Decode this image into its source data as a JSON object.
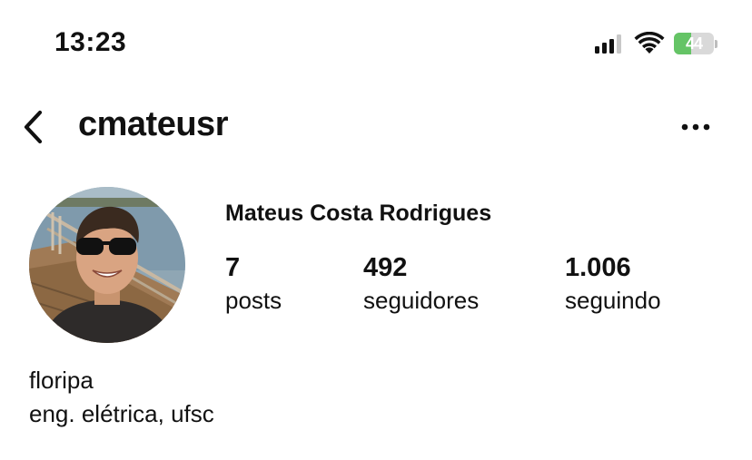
{
  "status_bar": {
    "time": "13:23",
    "battery_level": "44",
    "battery_fraction": 0.44,
    "icons": [
      "signal-icon",
      "wifi-icon",
      "battery-icon"
    ]
  },
  "header": {
    "username": "cmateusr",
    "icons": [
      "back-chevron-icon",
      "more-options-icon"
    ]
  },
  "profile": {
    "full_name": "Mateus Costa Rodrigues",
    "stats": [
      {
        "value": "7",
        "label": "posts"
      },
      {
        "value": "492",
        "label": "seguidores"
      },
      {
        "value": "1.006",
        "label": "seguindo"
      }
    ],
    "bio": [
      "floripa",
      "eng. elétrica, ufsc"
    ]
  },
  "colors": {
    "text": "#111111",
    "background": "#ffffff",
    "battery_green": "#65c466"
  }
}
